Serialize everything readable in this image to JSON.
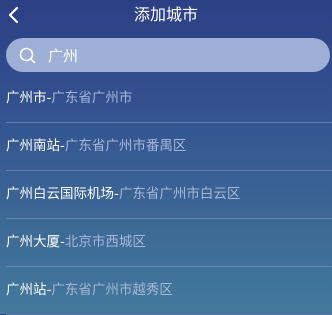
{
  "header": {
    "title": "添加城市",
    "back_icon": "chevron-left-icon"
  },
  "search": {
    "icon": "search-icon",
    "value": "广州"
  },
  "results": [
    {
      "name": "广州市",
      "separator": "-",
      "region": "广东省广州市"
    },
    {
      "name": "广州南站",
      "separator": "-",
      "region": "广东省广州市番禺区"
    },
    {
      "name": "广州白云国际机场",
      "separator": "-",
      "region": "广东省广州市白云区"
    },
    {
      "name": "广州大厦",
      "separator": "-",
      "region": "北京市西城区"
    },
    {
      "name": "广州站",
      "separator": "-",
      "region": "广东省广州市越秀区"
    }
  ],
  "colors": {
    "background_top": "#2c3f86",
    "background_bottom": "#43799b",
    "search_box": "#becdeb",
    "region_text": "#a6b6d8",
    "primary_text": "#ffffff"
  }
}
